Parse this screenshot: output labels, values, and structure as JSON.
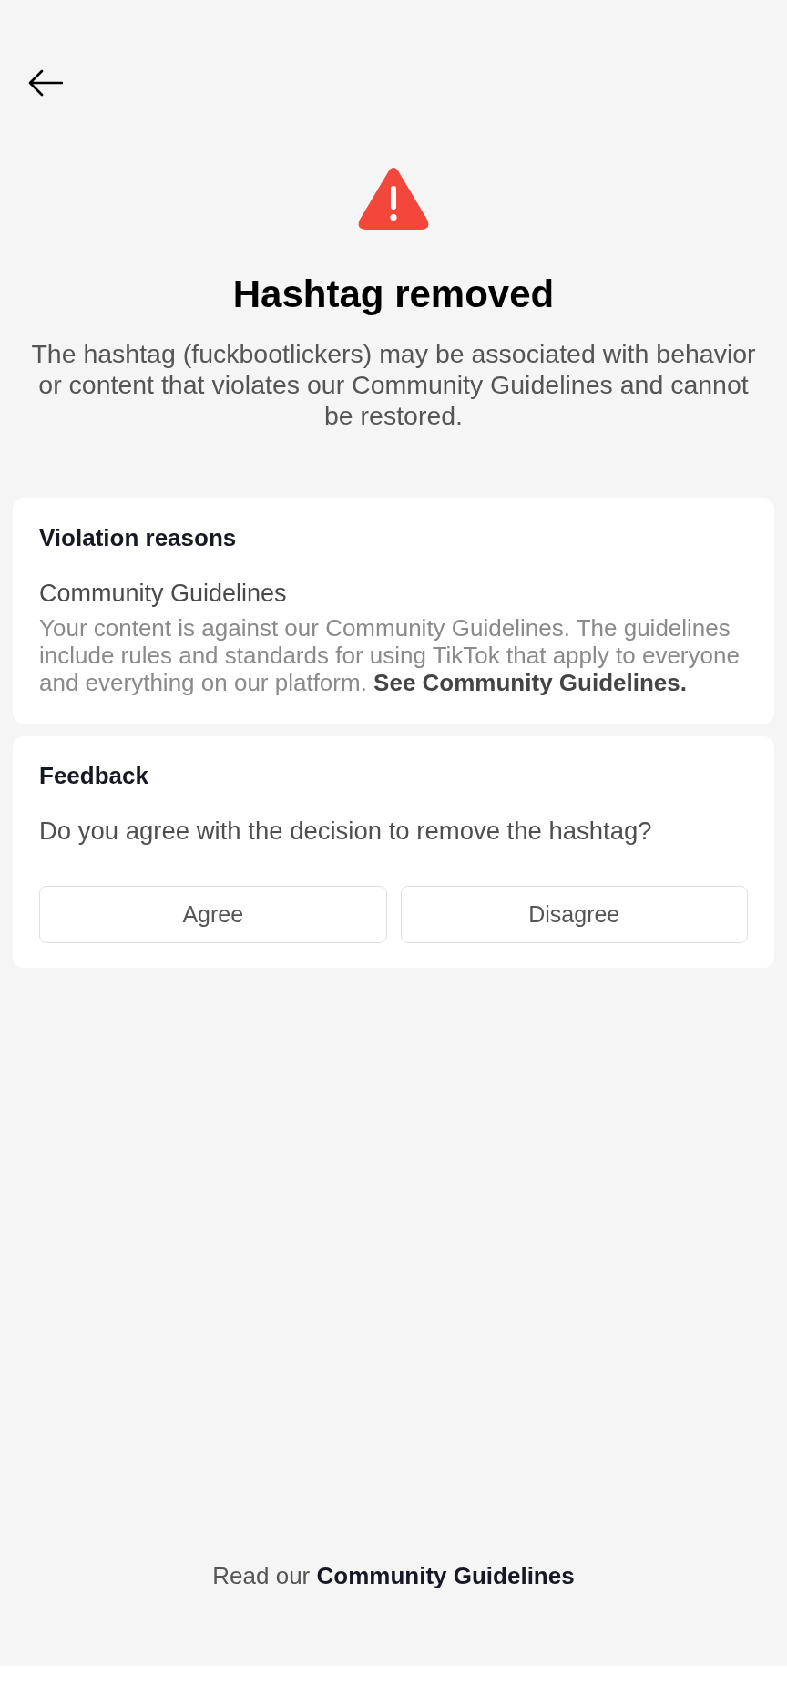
{
  "header": {
    "title": "Hashtag removed",
    "description": "The hashtag (fuckbootlickers) may be associated with behavior or content that violates our Community Guidelines and cannot be restored."
  },
  "violation": {
    "heading": "Violation reasons",
    "reason_title": "Community Guidelines",
    "description": "Your content is against our Community Guidelines. The guidelines include rules and standards for using TikTok that apply to everyone and everything on our platform.",
    "link": "See Community Guidelines."
  },
  "feedback": {
    "heading": "Feedback",
    "question": "Do you agree with the decision to remove the hashtag?",
    "buttons": [
      "Agree",
      "Disagree"
    ]
  },
  "footer": {
    "text": "Read our",
    "link": "Community Guidelines"
  }
}
